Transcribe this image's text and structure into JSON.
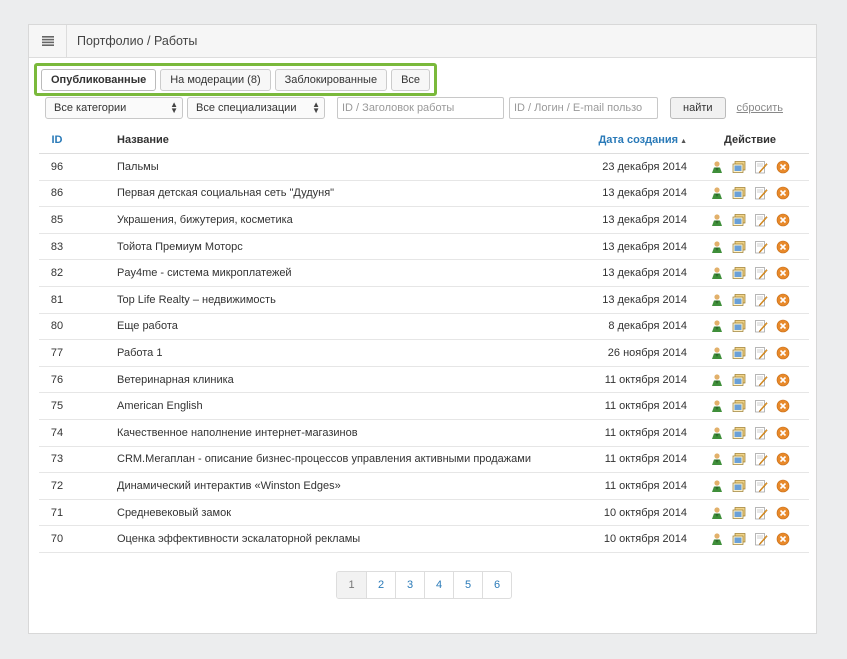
{
  "header": {
    "breadcrumb": "Портфолио / Работы",
    "menu_icon": "hamburger-menu-icon"
  },
  "tabs": [
    {
      "label": "Опубликованные",
      "active": true
    },
    {
      "label": "На модерации (8)",
      "active": false
    },
    {
      "label": "Заблокированные",
      "active": false
    },
    {
      "label": "Все",
      "active": false
    }
  ],
  "filters": {
    "category": "Все категории",
    "specialization": "Все специализации",
    "id_title_placeholder": "ID / Заголовок работы",
    "user_placeholder": "ID / Логин / E-mail пользо",
    "find_label": "найти",
    "reset_label": "сбросить"
  },
  "table": {
    "columns": {
      "id": "ID",
      "name": "Название",
      "date": "Дата создания",
      "action": "Действие"
    },
    "rows": [
      {
        "id": "96",
        "name": "Пальмы",
        "date": "23 декабря 2014"
      },
      {
        "id": "86",
        "name": "Первая детская социальная сеть \"Дудуня\"",
        "date": "13 декабря 2014"
      },
      {
        "id": "85",
        "name": "Украшения, бижутерия, косметика",
        "date": "13 декабря 2014"
      },
      {
        "id": "83",
        "name": "Тойота Премиум Моторс",
        "date": "13 декабря 2014"
      },
      {
        "id": "82",
        "name": "Pay4me - система микроплатежей",
        "date": "13 декабря 2014"
      },
      {
        "id": "81",
        "name": "Top Life Realty – недвижимость",
        "date": "13 декабря 2014"
      },
      {
        "id": "80",
        "name": "Еще работа",
        "date": "8 декабря 2014"
      },
      {
        "id": "77",
        "name": "Работа 1",
        "date": "26 ноября 2014"
      },
      {
        "id": "76",
        "name": "Ветеринарная клиника",
        "date": "11 октября 2014"
      },
      {
        "id": "75",
        "name": "American English",
        "date": "11 октября 2014"
      },
      {
        "id": "74",
        "name": "Качественное наполнение интернет-магазинов",
        "date": "11 октября 2014"
      },
      {
        "id": "73",
        "name": "CRM.Мегаплан - описание бизнес-процессов управления активными продажами",
        "date": "11 октября 2014"
      },
      {
        "id": "72",
        "name": "Динамический интерактив «Winston Edges»",
        "date": "11 октября 2014"
      },
      {
        "id": "71",
        "name": "Средневековый замок",
        "date": "10 октября 2014"
      },
      {
        "id": "70",
        "name": "Оценка эффективности эскалаторной рекламы",
        "date": "10 октября 2014"
      }
    ],
    "row_actions": [
      "user-icon",
      "gallery-icon",
      "edit-icon",
      "delete-icon"
    ]
  },
  "pagination": {
    "pages": [
      "1",
      "2",
      "3",
      "4",
      "5",
      "6"
    ],
    "current": "1"
  },
  "colors": {
    "accent_green": "#7ab93b",
    "link_blue": "#2a7ab8",
    "delete_orange": "#e8892a"
  }
}
